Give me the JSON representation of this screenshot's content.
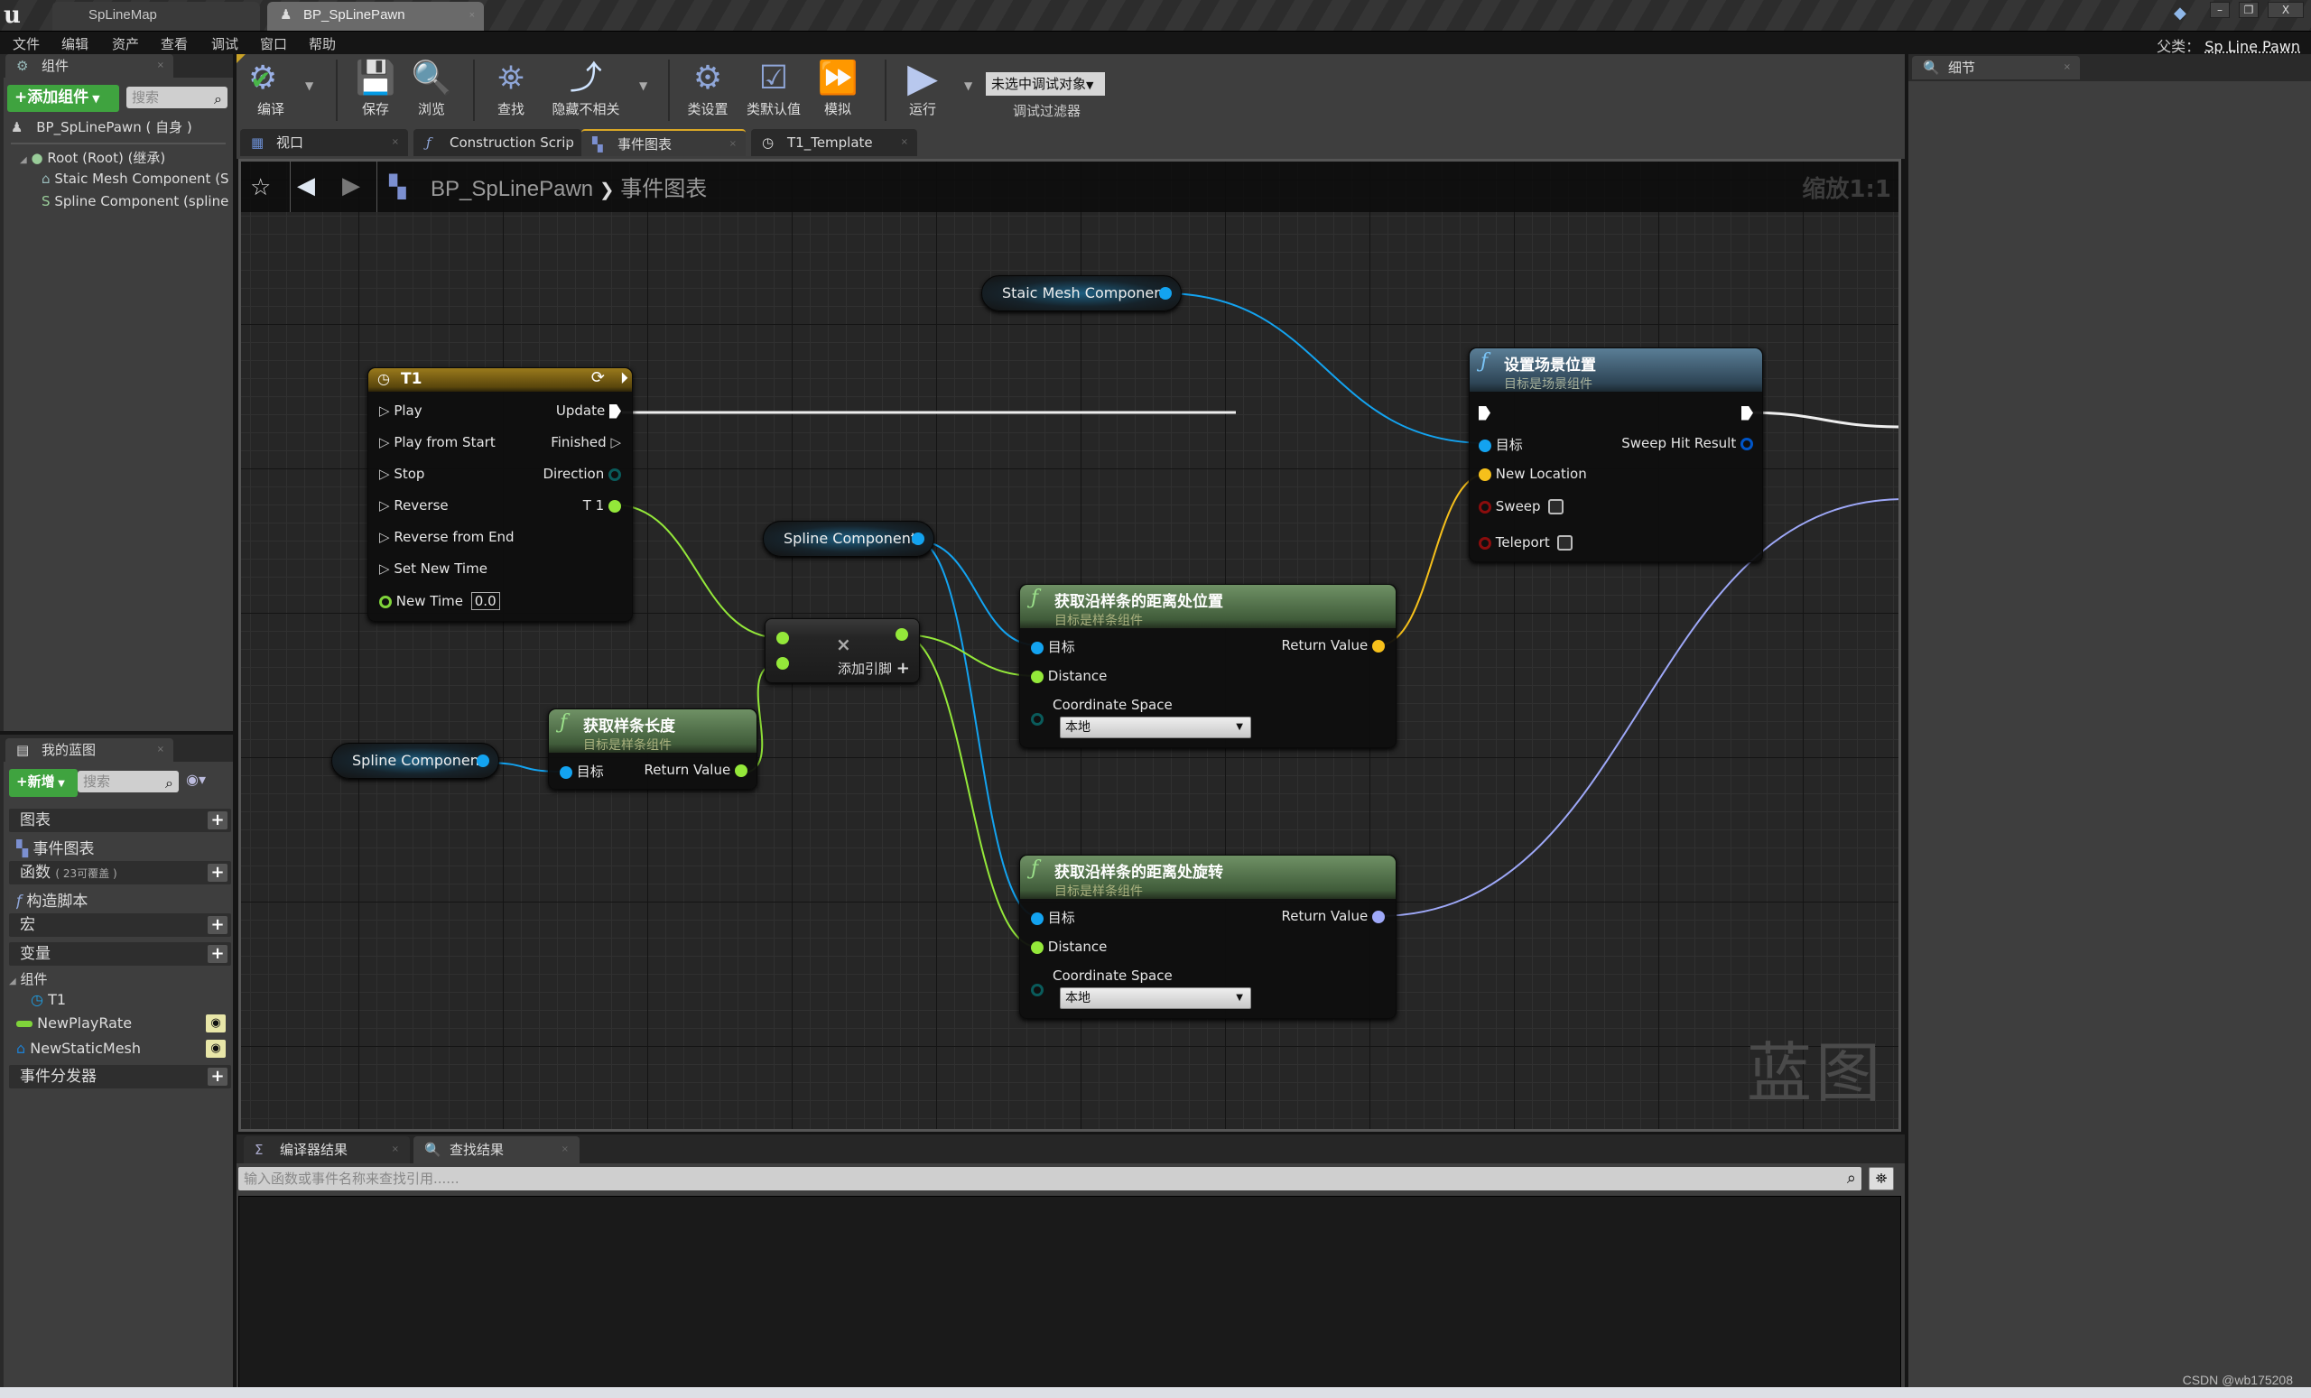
{
  "titlebar": {
    "tabs": [
      {
        "label": "SpLineMap",
        "active": false
      },
      {
        "label": "BP_SpLinePawn",
        "active": true
      }
    ],
    "window_buttons": [
      "minimize",
      "restore",
      "close"
    ]
  },
  "menubar": {
    "items": [
      "文件",
      "编辑",
      "资产",
      "查看",
      "调试",
      "窗口",
      "帮助"
    ],
    "parent_label": "父类：",
    "parent_value": "Sp Line Pawn"
  },
  "components_panel": {
    "tab": "组件",
    "add_button": "添加组件",
    "search_placeholder": "搜索",
    "self_item": "BP_SpLinePawn ( 自身 )",
    "tree": [
      {
        "label": "Root (Root) (继承)",
        "icon": "sphere-icon"
      },
      {
        "label": "Staic Mesh Component (St",
        "icon": "static-mesh-icon"
      },
      {
        "label": "Spline Component (spline(",
        "icon": "spline-icon"
      }
    ]
  },
  "toolbar": {
    "buttons": [
      {
        "label": "编译",
        "icon": "compile-icon"
      },
      {
        "label": "保存",
        "icon": "save-icon"
      },
      {
        "label": "浏览",
        "icon": "browse-icon"
      },
      {
        "label": "查找",
        "icon": "find-icon"
      },
      {
        "label": "隐藏不相关",
        "icon": "hide-unrelated-icon"
      },
      {
        "label": "类设置",
        "icon": "class-settings-icon"
      },
      {
        "label": "类默认值",
        "icon": "class-defaults-icon"
      },
      {
        "label": "模拟",
        "icon": "simulate-icon"
      },
      {
        "label": "运行",
        "icon": "play-icon"
      }
    ],
    "debug_object": "未选中调试对象",
    "debug_filter_label": "调试过滤器"
  },
  "editor_tabs": [
    {
      "label": "视口",
      "icon": "viewport-icon",
      "active": false
    },
    {
      "label": "Construction Scrip",
      "icon": "function-icon",
      "active": false
    },
    {
      "label": "事件图表",
      "icon": "event-graph-icon",
      "active": true
    },
    {
      "label": "T1_Template",
      "icon": "timeline-icon",
      "active": false
    }
  ],
  "graph": {
    "breadcrumb_root": "BP_SpLinePawn",
    "breadcrumb_sep": "❯",
    "breadcrumb_current": "事件图表",
    "zoom": "缩放1:1",
    "watermark": "蓝图",
    "nodes": {
      "static_mesh_var": "Staic Mesh Component",
      "spline_var_top": "Spline Component",
      "spline_var_bottom": "Spline Component",
      "timeline": {
        "title": "T1",
        "inputs": [
          "Play",
          "Play from Start",
          "Stop",
          "Reverse",
          "Reverse from End",
          "Set New Time"
        ],
        "new_time_label": "New Time",
        "new_time_value": "0.0",
        "outputs": [
          "Update",
          "Finished",
          "Direction",
          "T 1"
        ]
      },
      "set_world_location": {
        "title": "设置场景位置",
        "subtitle": "目标是场景组件",
        "target": "目标",
        "new_location": "New Location",
        "sweep": "Sweep",
        "teleport": "Teleport",
        "sweep_checked": false,
        "teleport_checked": false,
        "sweep_hit_result": "Sweep Hit Result"
      },
      "get_spline_length": {
        "title": "获取样条长度",
        "subtitle": "目标是样条组件",
        "target": "目标",
        "return_value": "Return Value"
      },
      "multiply": {
        "symbol": "×",
        "add_pin": "添加引脚"
      },
      "get_location_at_distance": {
        "title": "获取沿样条的距离处位置",
        "subtitle": "目标是样条组件",
        "target": "目标",
        "distance": "Distance",
        "coord_space": "Coordinate Space",
        "coord_value": "本地",
        "return_value": "Return Value"
      },
      "get_rotation_at_distance": {
        "title": "获取沿样条的距离处旋转",
        "subtitle": "目标是样条组件",
        "target": "目标",
        "distance": "Distance",
        "coord_space": "Coordinate Space",
        "coord_value": "本地",
        "return_value": "Return Value"
      }
    }
  },
  "my_blueprint": {
    "tab": "我的蓝图",
    "new_button": "新增",
    "search_placeholder": "搜索",
    "sections": {
      "graphs": "图表",
      "graph_item": "事件图表",
      "functions": "函数",
      "functions_note": "( 23可覆盖 )",
      "function_item": "构造脚本",
      "macros": "宏",
      "variables": "变量",
      "components": "组件",
      "component_item": "T1",
      "var_items": [
        "NewPlayRate",
        "NewStaticMesh"
      ],
      "dispatchers": "事件分发器"
    }
  },
  "bottom_panel": {
    "tabs": [
      {
        "label": "编译器结果",
        "active": false
      },
      {
        "label": "查找结果",
        "active": true
      }
    ],
    "find_placeholder": "输入函数或事件名称来查找引用......"
  },
  "details_panel": {
    "tab": "细节"
  },
  "watermark_text": "CSDN @wb175208",
  "colors": {
    "object_pin": "#13a3f0",
    "float_pin": "#94e83a",
    "vector_pin": "#f6c01b",
    "rotator_pin": "#9ea8f8",
    "bool_pin": "#8b0d0d",
    "struct_pin": "#0055c8",
    "enum_pin": "#0a5b5b",
    "timeline_header": "#8a6a14",
    "pure_fn_header": "#587a50",
    "fn_header": "#4d6f87",
    "add_button_green": "#3fa33f"
  }
}
